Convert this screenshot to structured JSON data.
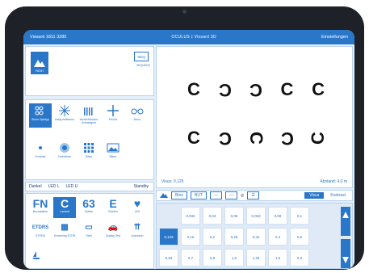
{
  "topbar": {
    "left": "Vissard 1811 3280",
    "center": "OCULUS ⟟ Vissard 3D",
    "right": "Einstellungen"
  },
  "left": {
    "mode_label": "REIH",
    "seq_button": "SEQ",
    "seq_label": "SEQUENZ",
    "categories": [
      {
        "label": "Sinus Optotyp",
        "icon": "optotype-icon"
      },
      {
        "label": "Astig-matismus",
        "icon": "starburst-icon"
      },
      {
        "label": "Worth/Maddox Schweigers",
        "icon": "bars-icon"
      },
      {
        "label": "Phoria",
        "icon": "cross-icon"
      },
      {
        "label": "Binoc",
        "icon": "glasses-icon"
      },
      {
        "label": "Kontrast",
        "icon": "dot-icon"
      },
      {
        "label": "Farbsehen",
        "icon": "color-plate-icon"
      },
      {
        "label": "Gitter",
        "icon": "grid-icon"
      },
      {
        "label": "Bilder",
        "icon": "picture-icon"
      }
    ],
    "tool_row": [
      "Dunkel",
      "LED L",
      "LED U"
    ],
    "standby": "Standby",
    "options": [
      {
        "big": "FN",
        "label": "Buchstaben"
      },
      {
        "big": "C",
        "label": "Landolt"
      },
      {
        "big": "63",
        "label": "Zahlen"
      },
      {
        "big": "E",
        "label": "Snellen"
      },
      {
        "big": "♥",
        "label": "LEA"
      },
      {
        "big": "ETDRS",
        "label": "ETDRS"
      },
      {
        "big": "▦",
        "label": "Screening ETDR"
      },
      {
        "big": "▭",
        "label": "Tafel"
      },
      {
        "big": "🚗",
        "label": "Quality Test"
      },
      {
        "big": "⇈",
        "label": "Autobahn"
      }
    ]
  },
  "chart_display": {
    "row1": [
      "C",
      "C",
      "C",
      "C",
      "C"
    ],
    "row2": [
      "C",
      "C",
      "C",
      "C",
      "C"
    ],
    "visus": "Visus: 0,125",
    "abstand": "Abstand: 4,0 m"
  },
  "toolbar2": {
    "items": [
      "Bino",
      "BUT",
      "—",
      "—",
      "◎",
      "☰"
    ],
    "visus": "Visus",
    "kontrast": "Kontrast"
  },
  "values": {
    "row1": [
      "0,032",
      "0,04",
      "0,05",
      "0,063",
      "0,08",
      "0,1"
    ],
    "row2": [
      "0,125",
      "0,16",
      "0,2",
      "0,25",
      "0,32",
      "0,4",
      "0,5"
    ],
    "row3": [
      "0,63",
      "0,7",
      "0,8",
      "1,0",
      "1,25",
      "1,6",
      "2,0"
    ],
    "selected": "0,125"
  },
  "colors": {
    "accent": "#2a77c9",
    "bar": "#2a77c9",
    "background": "#e3effb"
  }
}
